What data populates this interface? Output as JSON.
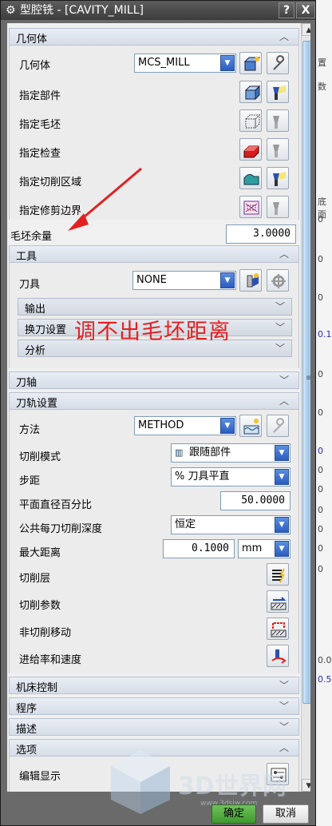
{
  "window": {
    "title": "型腔铣 - [CAVITY_MILL]",
    "help": "?",
    "close": "X"
  },
  "geometry_section": {
    "title": "几何体",
    "geometry_label": "几何体",
    "geometry_value": "MCS_MILL",
    "part_label": "指定部件",
    "blank_label": "指定毛坯",
    "check_label": "指定检查",
    "cut_area_label": "指定切削区域",
    "trim_label": "指定修剪边界"
  },
  "stock": {
    "label": "毛坯余量",
    "value": "3.0000"
  },
  "tool_section": {
    "title": "工具",
    "tool_label": "刀具",
    "tool_value": "NONE",
    "sub_output": "输出",
    "sub_change": "换刀设置",
    "sub_analysis": "分析"
  },
  "annotation_text": "调不出毛坯距离",
  "axis_section": {
    "title": "刀轴"
  },
  "path_section": {
    "title": "刀轨设置",
    "method_label": "方法",
    "method_value": "METHOD",
    "cut_pattern_label": "切削模式",
    "cut_pattern_value": "跟随部件",
    "stepover_label": "步距",
    "stepover_value": "% 刀具平直",
    "percent_label": "平面直径百分比",
    "percent_value": "50.0000",
    "depth_label": "公共每刀切削深度",
    "depth_value": "恒定",
    "max_dist_label": "最大距离",
    "max_dist_value": "0.1000",
    "max_dist_unit": "mm",
    "cut_levels_label": "切削层",
    "cut_params_label": "切削参数",
    "noncut_label": "非切削移动",
    "feeds_label": "进给率和速度"
  },
  "machine_section": {
    "title": "机床控制"
  },
  "program_section": {
    "title": "程序"
  },
  "description_section": {
    "title": "描述"
  },
  "options_section": {
    "title": "选项",
    "edit_display_label": "编辑显示"
  },
  "buttons": {
    "ok": "确定",
    "cancel": "取消"
  },
  "watermark": {
    "text": "3D世界网",
    "sub": "www.3dsjw.com"
  },
  "background_fragments": [
    "置",
    "数",
    "底面",
    "0",
    "0",
    "0",
    "0.1",
    "0",
    "0",
    "0",
    "0",
    "0",
    "0",
    "0",
    "0",
    "0",
    "0.0",
    "0.5"
  ],
  "colors": {
    "annotation": "#e32020",
    "ok_button": "#4fae3c",
    "scroll_thumb": "#9cc6ea"
  }
}
